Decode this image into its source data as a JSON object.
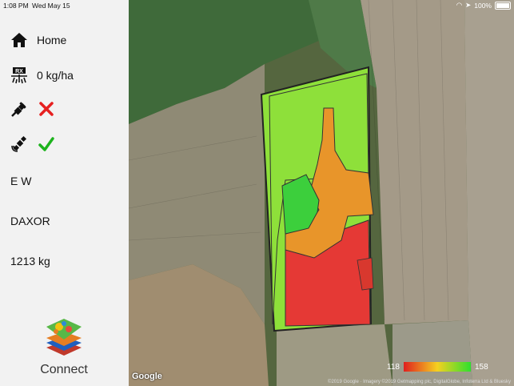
{
  "status_bar": {
    "time": "1:08 PM",
    "date": "Wed May 15",
    "battery": "100%"
  },
  "sidebar": {
    "home_label": "Home",
    "rate_label": "0 kg/ha",
    "rx_badge": "RX",
    "connection_ok": false,
    "gps_ok": true,
    "text1": "E W",
    "text2": "DAXOR",
    "text3": "1213 kg",
    "connect_label": "Connect"
  },
  "map": {
    "legend_min": "118",
    "legend_max": "158",
    "legend_colors": [
      "#e0201f",
      "#f5d020",
      "#2ee02e"
    ],
    "google_label": "Google",
    "attribution": "©2019 Google · Imagery ©2019 Getmapping plc, DigitalGlobe, Infoterra Ltd & Bluesky"
  },
  "colors": {
    "zone_red": "#e53935",
    "zone_orange": "#e8952a",
    "zone_lightgreen": "#8ee03a",
    "zone_green": "#3ccf3c",
    "check": "#1db31d",
    "cross": "#e62020"
  }
}
